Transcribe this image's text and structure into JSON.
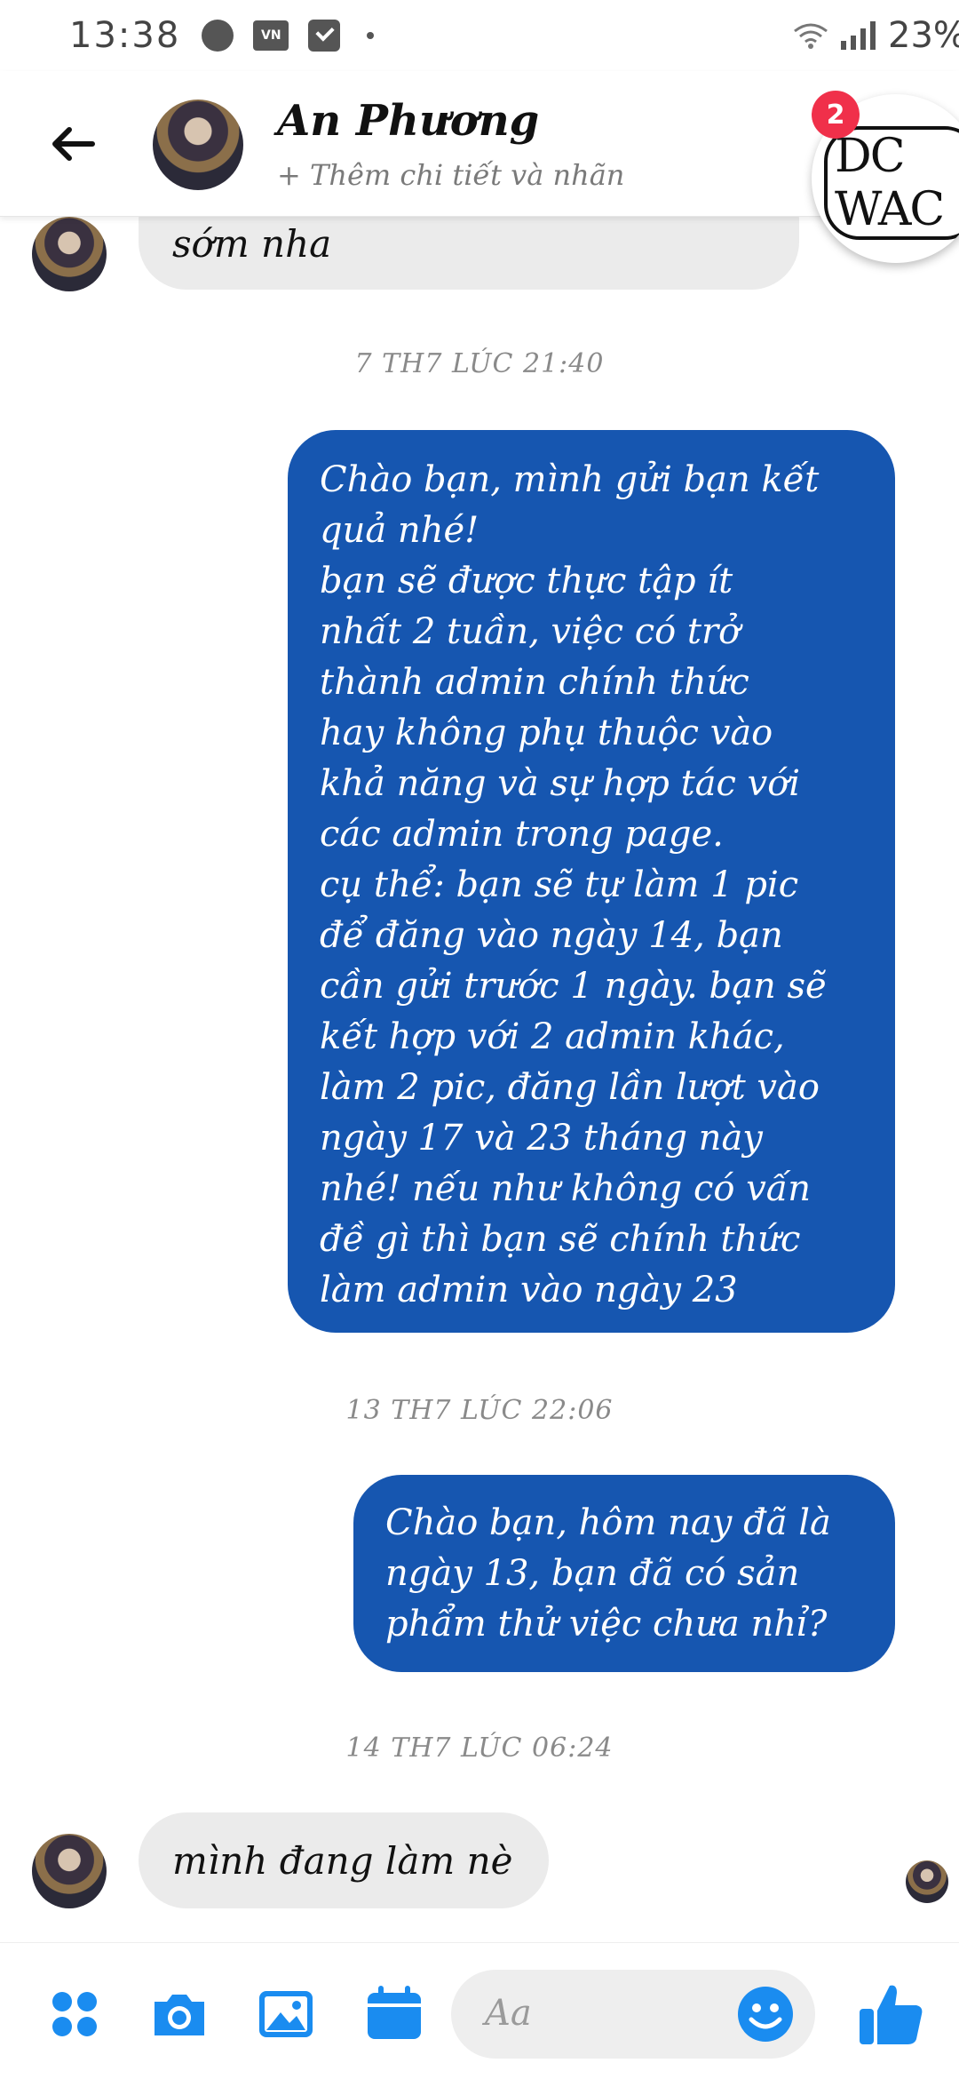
{
  "status_bar": {
    "time": "13:38",
    "battery": "23%"
  },
  "header": {
    "contact_name": "An Phương",
    "subtitle": "+ Thêm chi tiết và nhãn"
  },
  "chat_head": {
    "badge_count": "2",
    "logo_text": "DC WAC"
  },
  "messages": [
    {
      "type": "incoming",
      "text": "sớm nha"
    },
    {
      "type": "timestamp",
      "text": "7 TH7 LÚC 21:40"
    },
    {
      "type": "outgoing",
      "text": "Chào bạn, mình gửi bạn kết\nquả nhé!\nbạn sẽ được thực tập ít\nnhất 2 tuần, việc có trở\nthành admin chính thức\nhay không phụ thuộc vào\nkhả năng và sự hợp tác với\ncác admin trong page.\ncụ thể: bạn sẽ tự làm 1 pic\nđể đăng vào ngày 14, bạn\ncần gửi trước 1 ngày. bạn sẽ\nkết hợp với 2 admin khác,\nlàm 2 pic, đăng lần lượt vào\nngày 17 và 23 tháng này\nnhé! nếu như không có vấn\nđề gì thì bạn sẽ chính thức\nlàm admin vào ngày 23"
    },
    {
      "type": "timestamp",
      "text": "13 TH7 LÚC 22:06"
    },
    {
      "type": "outgoing",
      "text": "Chào bạn, hôm nay đã là\nngày 13, bạn đã có sản\nphẩm thử việc chưa nhỉ?"
    },
    {
      "type": "timestamp",
      "text": "14 TH7 LÚC 06:24"
    },
    {
      "type": "incoming",
      "text": "mình đang làm nè"
    }
  ],
  "composer": {
    "placeholder": "Aa"
  },
  "colors": {
    "outgoing_bubble": "#1656b0",
    "incoming_bubble": "#ebebeb",
    "accent": "#1a8cf0",
    "badge": "#f0304a"
  },
  "icons": {
    "back": "back-arrow-icon",
    "apps": "four-dots-icon",
    "camera": "camera-icon",
    "gallery": "image-icon",
    "calendar": "calendar-icon",
    "emoji": "smiley-icon",
    "like": "thumbs-up-icon"
  }
}
